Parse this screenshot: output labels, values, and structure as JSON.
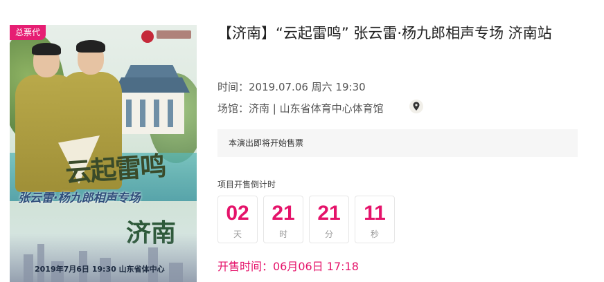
{
  "poster": {
    "badge": "总票代",
    "calligraphy": "云起雷鸣",
    "performers": "张云雷·杨九郎相声专场",
    "city": "济南",
    "date_line": "2019年7月6日  19:30  山东省体中心"
  },
  "event": {
    "title": "【济南】“云起雷鸣” 张云雷·杨九郎相声专场 济南站",
    "time_label": "时间：",
    "time_value": "2019.07.06 周六 19:30",
    "venue_label": "场馆：",
    "venue_value": "济南 | 山东省体育中心体育馆"
  },
  "notice": "本演出即将开始售票",
  "countdown": {
    "label": "项目开售倒计时",
    "units": [
      {
        "value": "02",
        "unit": "天"
      },
      {
        "value": "21",
        "unit": "时"
      },
      {
        "value": "21",
        "unit": "分"
      },
      {
        "value": "11",
        "unit": "秒"
      }
    ]
  },
  "sale_time": "开售时间：06月06日 17:18",
  "colors": {
    "accent": "#e5136a",
    "badge": "#e61e73"
  },
  "icons": {
    "map": "map-pin-icon"
  }
}
